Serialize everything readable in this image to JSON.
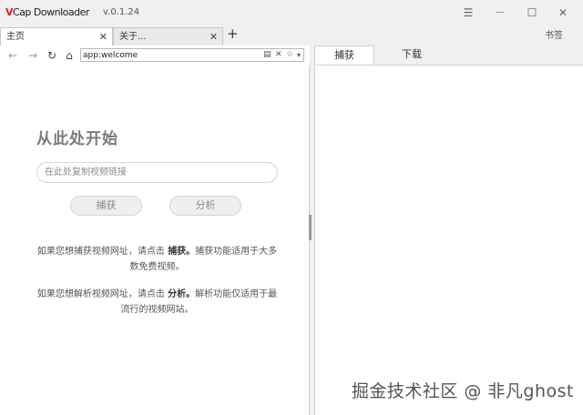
{
  "app": {
    "logo_v": "V",
    "logo_rest": "Cap Downloader",
    "version": "v.0.1.24"
  },
  "window_controls": {
    "menu": "☰",
    "minimize": "—",
    "maximize": "☐",
    "close": "✕"
  },
  "tabs": [
    {
      "label": "主页",
      "close": "✕"
    },
    {
      "label": "关于...",
      "close": "✕"
    }
  ],
  "new_tab": "+",
  "bookmarks_label": "书签",
  "nav": {
    "back": "←",
    "forward": "→",
    "reload": "↻",
    "home": "⌂",
    "address_value": "app:welcome",
    "addr_page_icon": "▤",
    "addr_clear": "✕",
    "addr_star": "☆",
    "addr_dropdown": "▾"
  },
  "welcome": {
    "heading": "从此处开始",
    "link_placeholder": "在此处复制视频链接",
    "capture_button": "捕获",
    "analyze_button": "分析",
    "para1_pre": "如果您想捕获视频网址，请点击 ",
    "para1_bold": "捕获。",
    "para1_post": "捕获功能适用于大多数免费视频。",
    "para2_pre": "如果您想解析视频网址，请点击 ",
    "para2_bold": "分析。",
    "para2_post": "解析功能仅适用于最流行的视频网站。"
  },
  "right_panel": {
    "tabs": [
      "捕获",
      "下载"
    ]
  },
  "watermark": "掘金技术社区 @ 非凡ghost"
}
